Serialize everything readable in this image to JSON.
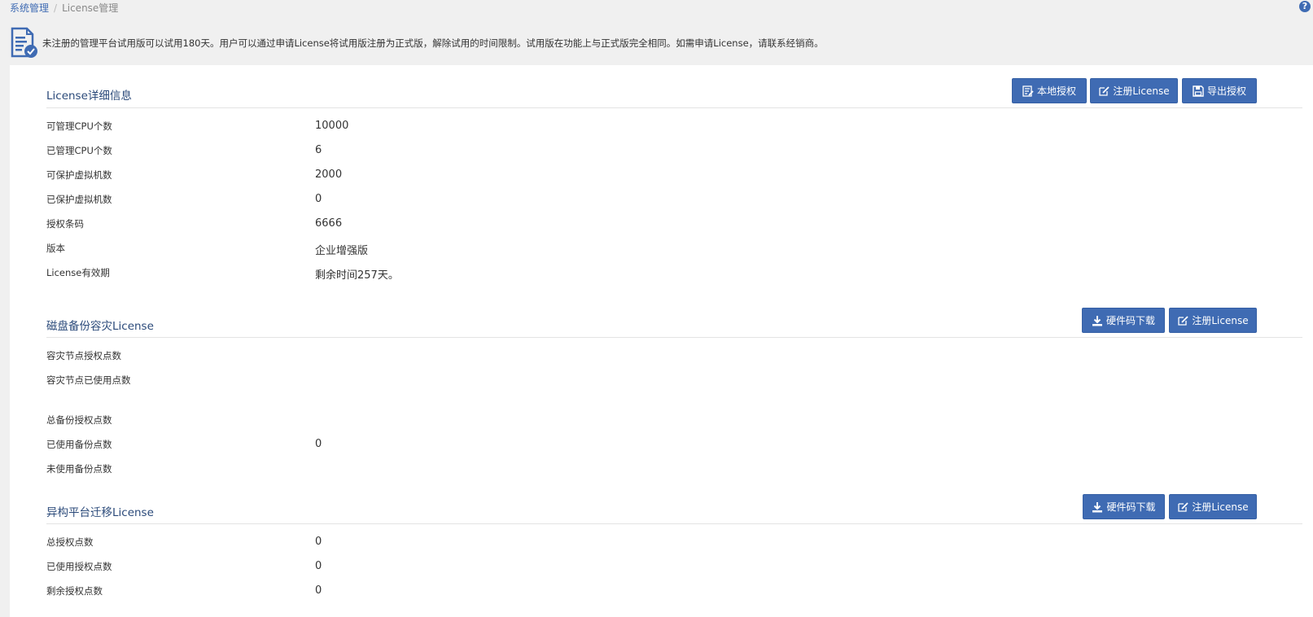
{
  "breadcrumb": {
    "root": "系统管理",
    "current": "License管理"
  },
  "help": "?",
  "notice": {
    "text": "未注册的管理平台试用版可以试用180天。用户可以通过申请License将试用版注册为正式版，解除试用的时间限制。试用版在功能上与正式版完全相同。如需申请License，请联系经销商。"
  },
  "license_detail": {
    "title": "License详细信息",
    "buttons": {
      "local": "本地授权",
      "register": "注册License",
      "export": "导出授权"
    },
    "rows": [
      {
        "label": "可管理CPU个数",
        "value": "10000"
      },
      {
        "label": "已管理CPU个数",
        "value": "6"
      },
      {
        "label": "可保护虚拟机数",
        "value": "2000"
      },
      {
        "label": "已保护虚拟机数",
        "value": "0"
      },
      {
        "label": "授权条码",
        "value": "6666"
      },
      {
        "label": "版本",
        "value": "企业增强版"
      },
      {
        "label": "License有效期",
        "value": "剩余时间257天。"
      }
    ]
  },
  "disk_backup": {
    "title": "磁盘备份容灾License",
    "buttons": {
      "download": "硬件码下载",
      "register": "注册License"
    },
    "rows": [
      {
        "label": "容灾节点授权点数",
        "value": ""
      },
      {
        "label": "容灾节点已使用点数",
        "value": ""
      },
      {
        "label": "总备份授权点数",
        "value": ""
      },
      {
        "label": "已使用备份点数",
        "value": "0"
      },
      {
        "label": "未使用备份点数",
        "value": ""
      }
    ]
  },
  "migration": {
    "title": "异构平台迁移License",
    "buttons": {
      "download": "硬件码下载",
      "register": "注册License"
    },
    "rows": [
      {
        "label": "总授权点数",
        "value": "0"
      },
      {
        "label": "已使用授权点数",
        "value": "0"
      },
      {
        "label": "剩余授权点数",
        "value": "0"
      }
    ]
  },
  "colors": {
    "accent": "#3f6bb3",
    "title": "#2b4a7a"
  }
}
